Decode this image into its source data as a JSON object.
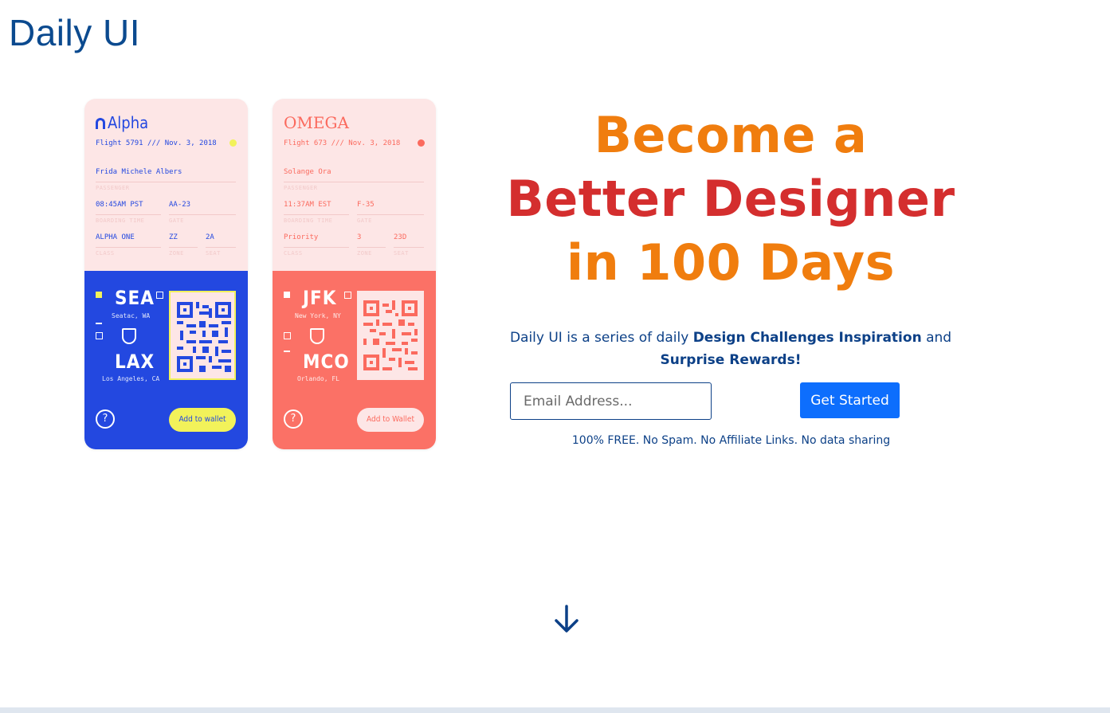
{
  "header": {
    "logo": "Daily UI"
  },
  "tickets": [
    {
      "brand": "Alpha",
      "flight": "Flight 5791 /// Nov. 3, 2018",
      "passenger": "Frida Michele Albers",
      "passenger_label": "PASSENGER",
      "time": "08:45AM PST",
      "time_label": "BOARDING TIME",
      "gate": "AA-23",
      "gate_label": "GATE",
      "class": "ALPHA ONE",
      "class_label": "CLASS",
      "zone": "ZZ",
      "zone_label": "ZONE",
      "seat": "2A",
      "seat_label": "SEAT",
      "from_code": "SEA",
      "from_city": "Seatac, WA",
      "to_code": "LAX",
      "to_city": "Los Angeles, CA",
      "help": "?",
      "wallet": "Add to wallet",
      "accent": "#2348e0"
    },
    {
      "brand": "OMEGA",
      "flight": "Flight 673 /// Nov. 3, 2018",
      "passenger": "Solange Ora",
      "passenger_label": "PASSENGER",
      "time": "11:37AM EST",
      "time_label": "BOARDING TIME",
      "gate": "F-35",
      "gate_label": "GATE",
      "class": "Priority",
      "class_label": "CLASS",
      "zone": "3",
      "zone_label": "ZONE",
      "seat": "23D",
      "seat_label": "SEAT",
      "from_code": "JFK",
      "from_city": "New York, NY",
      "to_code": "MCO",
      "to_city": "Orlando, FL",
      "help": "?",
      "wallet": "Add to Wallet",
      "accent": "#fb7166"
    }
  ],
  "hero": {
    "line1": "Become a",
    "line2": "Better Designer",
    "line3": "in 100 Days"
  },
  "lead": {
    "part1": "Daily UI is a series of daily ",
    "bold1": "Design Challenges Inspiration",
    "part2": " and ",
    "bold2": "Surprise Rewards!"
  },
  "signup": {
    "email_placeholder": "Email Address...",
    "cta_label": "Get Started",
    "fine_print": "100% FREE. No Spam. No Affiliate Links. No data sharing"
  },
  "colors": {
    "brand_blue": "#0c4087",
    "orange": "#f07d0e",
    "red": "#d42e2e",
    "button": "#0d6efd"
  },
  "icons": {
    "scroll": "arrow-down-icon"
  }
}
